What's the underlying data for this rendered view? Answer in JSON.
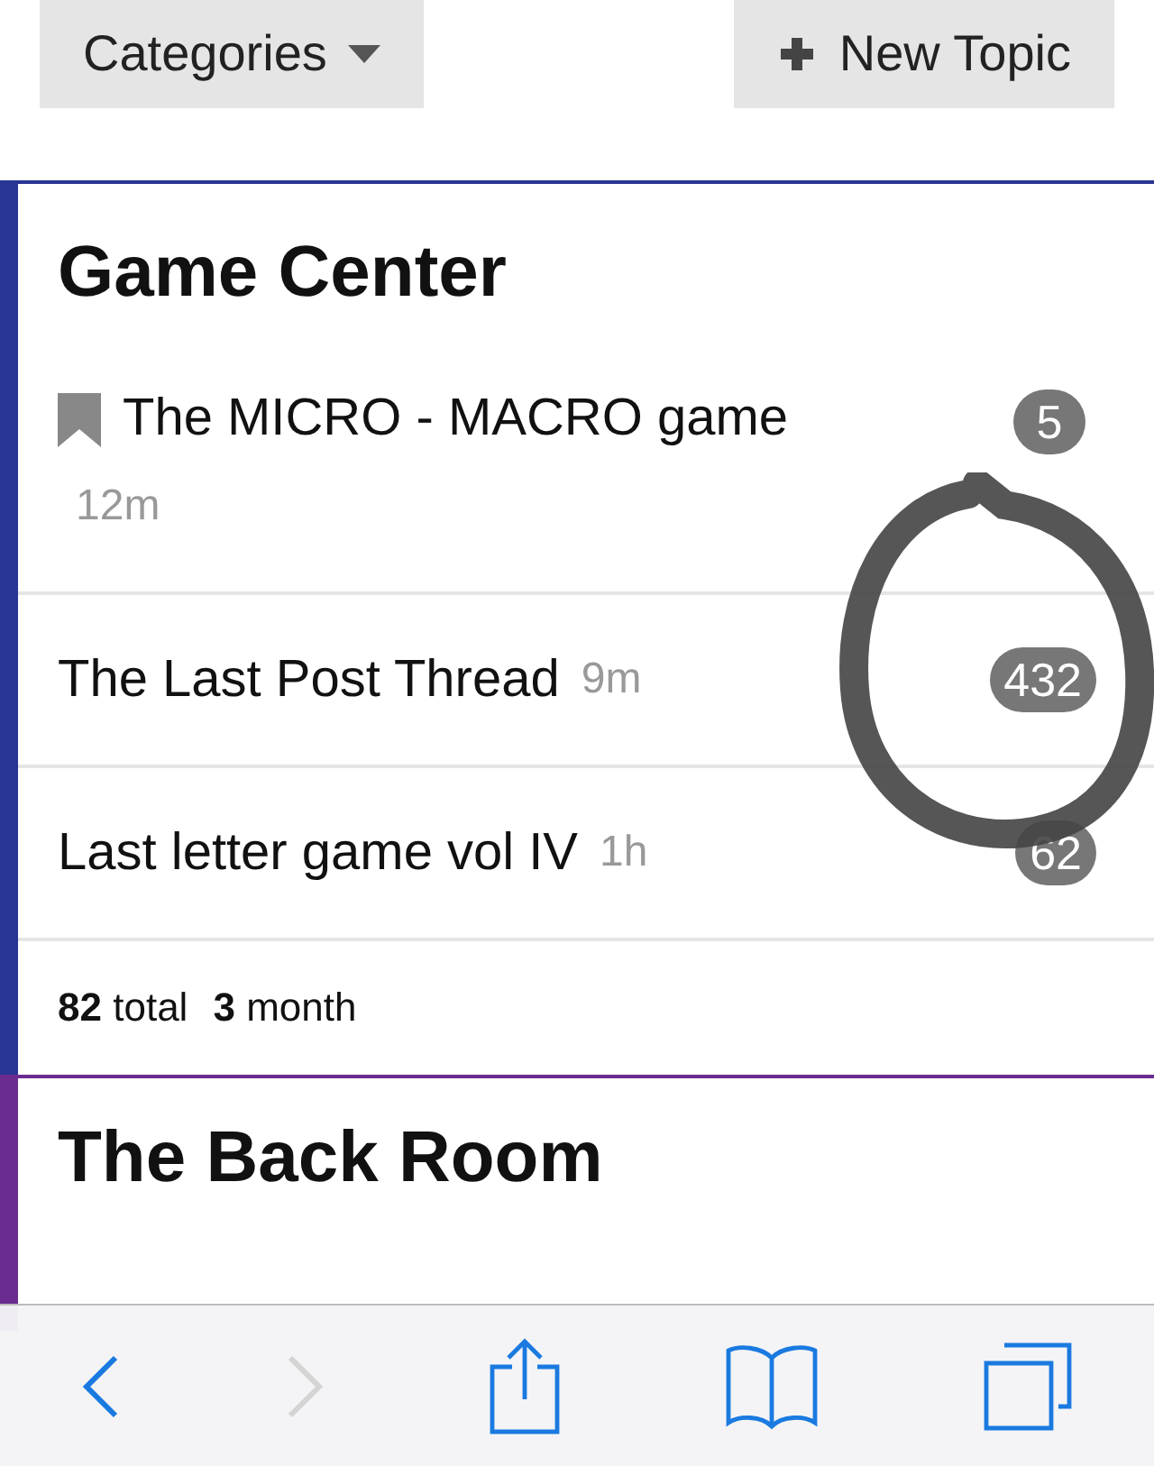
{
  "header": {
    "buttons": [
      {
        "label": "Categories",
        "kind": "dropdown"
      },
      {
        "label": "New Topic",
        "kind": "create"
      }
    ]
  },
  "categories": [
    {
      "name": "Game Center",
      "color": "#283593",
      "topics": [
        {
          "title": "The MICRO - MACRO game",
          "age": "12m",
          "replies": "5",
          "bookmarked": true
        },
        {
          "title": "The Last Post Thread",
          "age": "9m",
          "replies": "432",
          "bookmarked": false
        },
        {
          "title": "Last letter game vol IV",
          "age": "1h",
          "replies": "62",
          "bookmarked": false
        }
      ],
      "stats": [
        {
          "count": "82",
          "unit": "total"
        },
        {
          "count": "3",
          "unit": "month"
        }
      ]
    },
    {
      "name": "The Back Room",
      "color": "#6a2c91"
    }
  ],
  "toolbar": {
    "buttons": [
      {
        "kind": "back",
        "disabled": false
      },
      {
        "kind": "forward",
        "disabled": true
      },
      {
        "kind": "share",
        "disabled": false
      },
      {
        "kind": "bookmarks",
        "disabled": false
      },
      {
        "kind": "tabs",
        "disabled": false
      }
    ]
  }
}
